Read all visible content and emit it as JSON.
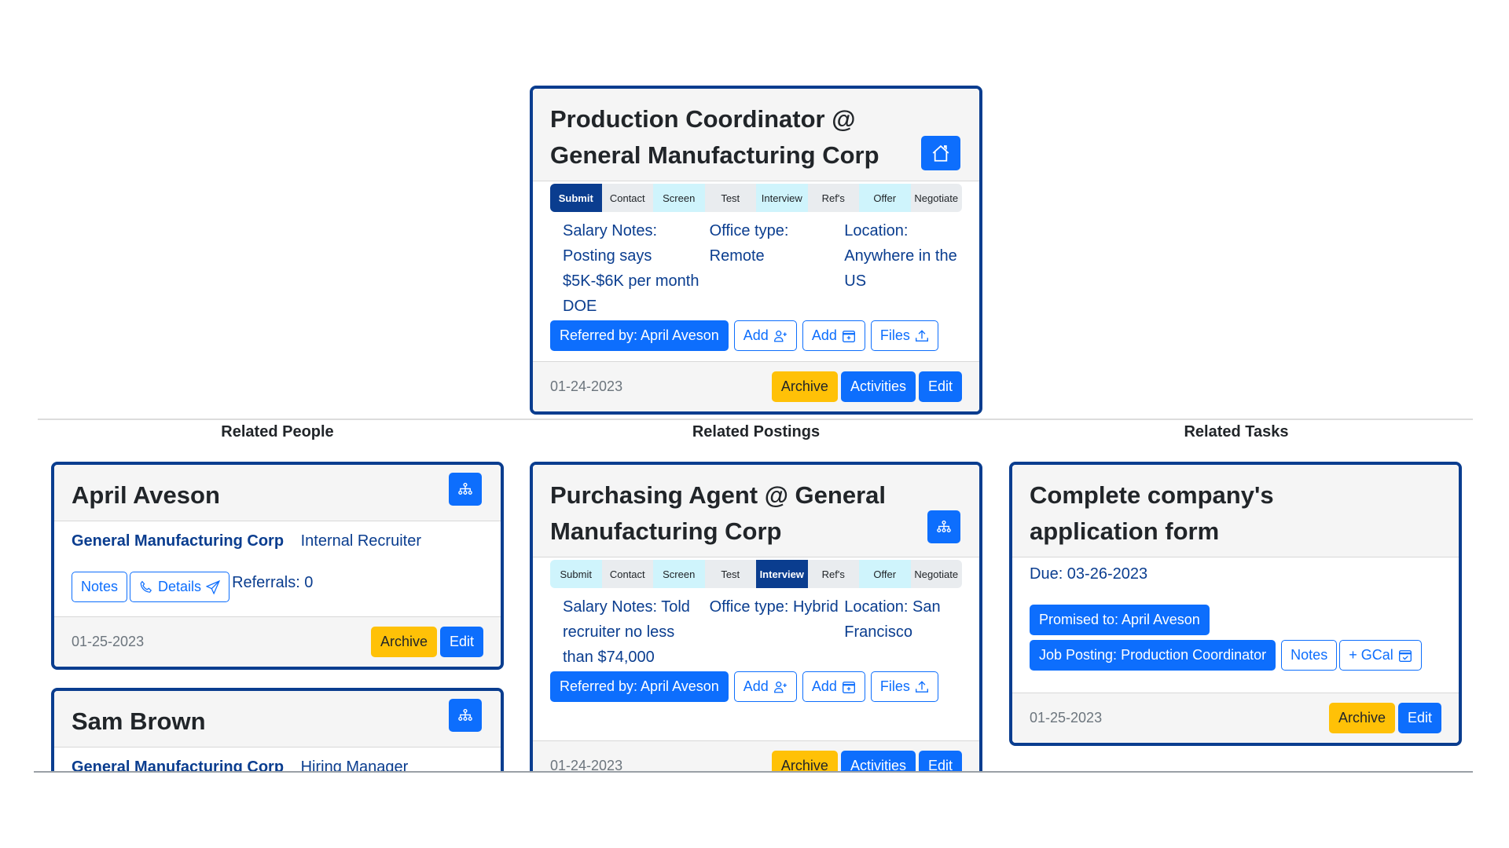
{
  "main_posting": {
    "title": "Production Coordinator @ General Manufacturing Corp",
    "icon": "house-icon",
    "stages": [
      {
        "label": "Submit",
        "state": "active"
      },
      {
        "label": "Contact",
        "state": "light"
      },
      {
        "label": "Screen",
        "state": "cyan"
      },
      {
        "label": "Test",
        "state": "light"
      },
      {
        "label": "Interview",
        "state": "cyan"
      },
      {
        "label": "Ref's",
        "state": "light"
      },
      {
        "label": "Offer",
        "state": "cyan"
      },
      {
        "label": "Negotiate",
        "state": "light"
      }
    ],
    "salary_notes": "Salary Notes: Posting says $5K-$6K per month DOE",
    "office_type": "Office type: Remote",
    "location": "Location: Anywhere in the US",
    "referred_by": "Referred by: April Aveson",
    "add_person_label": "Add",
    "add_event_label": "Add",
    "files_label": "Files",
    "date": "01-24-2023",
    "archive_label": "Archive",
    "activities_label": "Activities",
    "edit_label": "Edit"
  },
  "sections": {
    "people": "Related People",
    "postings": "Related Postings",
    "tasks": "Related Tasks"
  },
  "people": [
    {
      "name": "April Aveson",
      "company": "General Manufacturing Corp",
      "role": "Internal Recruiter",
      "notes_label": "Notes",
      "details_label": "Details",
      "referrals": "Referrals: 0",
      "date": "01-25-2023",
      "archive_label": "Archive",
      "edit_label": "Edit"
    },
    {
      "name": "Sam Brown",
      "company": "General Manufacturing Corp",
      "role": "Hiring Manager"
    }
  ],
  "related_posting": {
    "title": "Purchasing Agent @ General Manufacturing Corp",
    "stages": [
      {
        "label": "Submit",
        "state": "cyan"
      },
      {
        "label": "Contact",
        "state": "light"
      },
      {
        "label": "Screen",
        "state": "cyan"
      },
      {
        "label": "Test",
        "state": "light"
      },
      {
        "label": "Interview",
        "state": "active"
      },
      {
        "label": "Ref's",
        "state": "light"
      },
      {
        "label": "Offer",
        "state": "cyan"
      },
      {
        "label": "Negotiate",
        "state": "light"
      }
    ],
    "salary_notes": "Salary Notes: Told recruiter no less than $74,000",
    "office_type": "Office type: Hybrid",
    "location": "Location: San Francisco",
    "referred_by": "Referred by: April Aveson",
    "add_person_label": "Add",
    "add_event_label": "Add",
    "files_label": "Files",
    "date": "01-24-2023",
    "archive_label": "Archive",
    "activities_label": "Activities",
    "edit_label": "Edit"
  },
  "task": {
    "title": "Complete company's application form",
    "due": "Due: 03-26-2023",
    "promised_to": "Promised to: April Aveson",
    "job_posting": "Job Posting: Production Coordinator",
    "notes_label": "Notes",
    "gcal_label": "+ GCal",
    "date": "01-25-2023",
    "archive_label": "Archive",
    "edit_label": "Edit"
  }
}
